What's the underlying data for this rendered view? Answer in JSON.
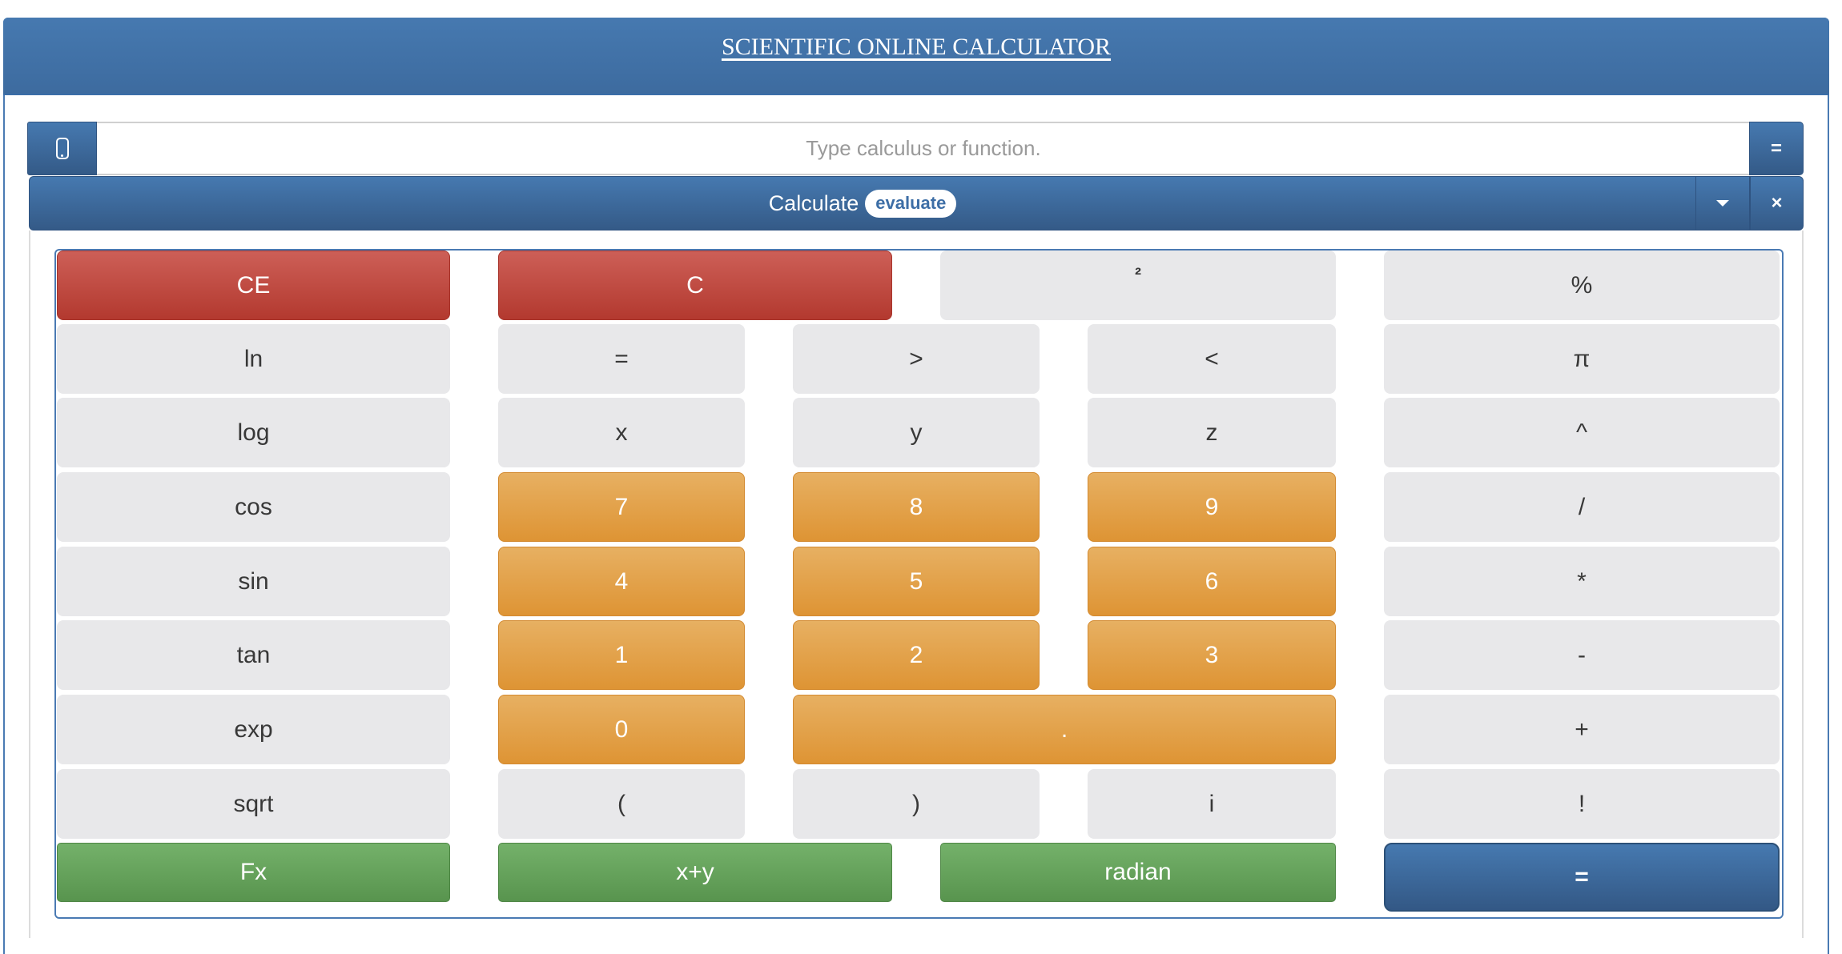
{
  "header": {
    "title": "SCIENTIFIC ONLINE CALCULATOR"
  },
  "input_row": {
    "mobile_icon": "mobile-phone-icon",
    "placeholder": "Type calculus or function.",
    "value": "",
    "equals_label": "="
  },
  "calc_bar": {
    "label": "Calculate",
    "badge": "evaluate",
    "dropdown_icon": "caret-down-icon",
    "close_label": "×"
  },
  "colors": {
    "primary_blue": "#4679b0",
    "clear_red": "#c44a42",
    "digit_orange": "#e2a14a",
    "function_green": "#66a35c",
    "neutral_gray": "#e8e8ea"
  },
  "keys": [
    {
      "label": "CE",
      "kind": "clear"
    },
    {
      "label": "C",
      "kind": "clear"
    },
    {
      "label": "²",
      "kind": "operator"
    },
    {
      "label": "%",
      "kind": "operator"
    },
    {
      "label": "ln",
      "kind": "function"
    },
    {
      "label": "=",
      "kind": "operator"
    },
    {
      "label": ">",
      "kind": "operator"
    },
    {
      "label": "<",
      "kind": "operator"
    },
    {
      "label": "π",
      "kind": "constant"
    },
    {
      "label": "log",
      "kind": "function"
    },
    {
      "label": "x",
      "kind": "variable"
    },
    {
      "label": "y",
      "kind": "variable"
    },
    {
      "label": "z",
      "kind": "variable"
    },
    {
      "label": "^",
      "kind": "operator"
    },
    {
      "label": "cos",
      "kind": "function"
    },
    {
      "label": "7",
      "kind": "digit"
    },
    {
      "label": "8",
      "kind": "digit"
    },
    {
      "label": "9",
      "kind": "digit"
    },
    {
      "label": "/",
      "kind": "operator"
    },
    {
      "label": "sin",
      "kind": "function"
    },
    {
      "label": "4",
      "kind": "digit"
    },
    {
      "label": "5",
      "kind": "digit"
    },
    {
      "label": "6",
      "kind": "digit"
    },
    {
      "label": "*",
      "kind": "operator"
    },
    {
      "label": "tan",
      "kind": "function"
    },
    {
      "label": "1",
      "kind": "digit"
    },
    {
      "label": "2",
      "kind": "digit"
    },
    {
      "label": "3",
      "kind": "digit"
    },
    {
      "label": "-",
      "kind": "operator"
    },
    {
      "label": "exp",
      "kind": "function"
    },
    {
      "label": "0",
      "kind": "digit"
    },
    {
      "label": ".",
      "kind": "digit"
    },
    {
      "label": "+",
      "kind": "operator"
    },
    {
      "label": "sqrt",
      "kind": "function"
    },
    {
      "label": "(",
      "kind": "operator"
    },
    {
      "label": ")",
      "kind": "operator"
    },
    {
      "label": "i",
      "kind": "constant"
    },
    {
      "label": "!",
      "kind": "operator"
    },
    {
      "label": "Fx",
      "kind": "mode"
    },
    {
      "label": "x+y",
      "kind": "mode"
    },
    {
      "label": "radian",
      "kind": "mode"
    },
    {
      "label": "=",
      "kind": "equals"
    }
  ]
}
